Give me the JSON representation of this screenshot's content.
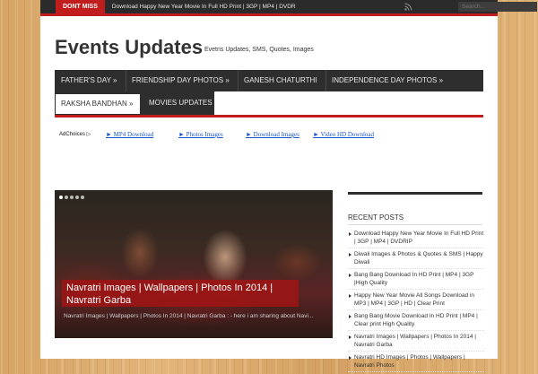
{
  "topbar": {
    "badge": "DONT MISS",
    "ticker": "Download Happy New Year Movie In Full HD Print | 3GP | MP4 | DVDR",
    "rss_icon": "rss-icon",
    "search_placeholder": "Search..."
  },
  "site": {
    "title": "Events Updates",
    "tagline": "Evetns Updates, SMS, Quotes, Images"
  },
  "nav": {
    "items": [
      "FATHER'S DAY »",
      "FRIENDSHIP DAY PHOTOS »",
      "GANESH CHATURTHI",
      "INDEPENDENCE DAY PHOTOS »",
      "RAKSHA BANDHAN »",
      "MOVIES UPDATES"
    ]
  },
  "ads": {
    "adchoices": "AdChoices ▷",
    "links": [
      "► MP4 Download",
      "► Photos Images",
      "► Download Images",
      "► Video HD Download"
    ]
  },
  "slider": {
    "title": "Navratri Images | Wallpapers | Photos In 2014 | Navratri Garba",
    "excerpt": "Navratri Images | Wallpapers | Photos In 2014 | Navratri Garba : - here i am sharing about Navi..."
  },
  "sidebar": {
    "heading": "RECENT POSTS",
    "posts": [
      "Download Happy New Year Movie In Full HD Print | 3GP | MP4 | DVDRIP",
      "Diwali Images & Photos & Quotes & SMS | Happy Diwali",
      "Bang Bang Download In HD Print | MP4 | 3GP |High Quality",
      "Happy New Year Movie All Songs Download in MP3 | MP4 | 3GP | HD | Clear Print",
      "Bang Bang Movie Download In HD Print | MP4 | Clear print High Quality",
      "Navratri Images | Wallpapers | Photos In 2014 | Navratri Garba",
      "Navratri HD Images | Photos | Wallpapers | Navratri Photos"
    ]
  },
  "colors": {
    "accent": "#c21d1d",
    "nav_bg": "#2e2e2e"
  }
}
